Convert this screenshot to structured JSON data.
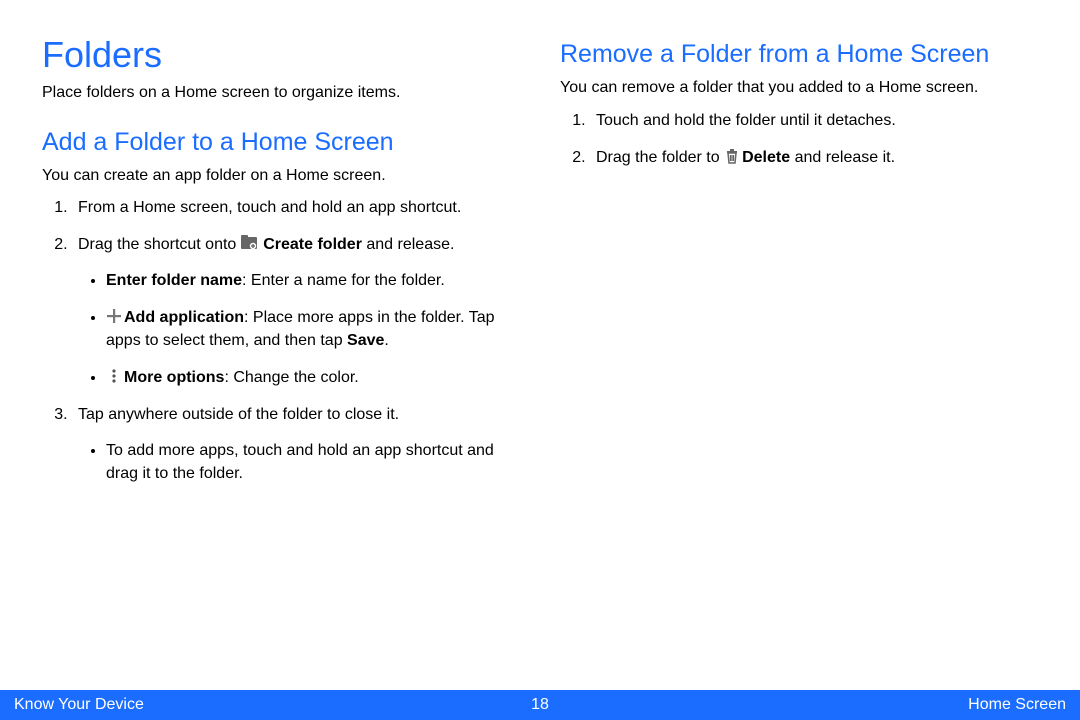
{
  "left": {
    "h1": "Folders",
    "intro": "Place folders on a Home screen to organize items.",
    "h2": "Add a Folder to a Home Screen",
    "p": "You can create an app folder on a Home screen.",
    "step1": "From a Home screen, touch and hold an app shortcut.",
    "step2_a": "Drag the shortcut onto ",
    "step2_bold": "Create folder",
    "step2_b": " and release.",
    "b1_bold": "Enter folder name",
    "b1_rest": ": Enter a name for the folder.",
    "b2_bold": "Add application",
    "b2_rest": ": Place more apps in the folder. Tap apps to select them, and then tap ",
    "b2_bold2": "Save",
    "b2_rest2": ".",
    "b3_bold": "More options",
    "b3_rest": ": Change the color.",
    "step3": "Tap anywhere outside of the folder to close it.",
    "s3b1": "To add more apps, touch and hold an app shortcut and drag it to the folder."
  },
  "right": {
    "h2": "Remove a Folder from a Home Screen",
    "p": "You can remove a folder that you added to a Home screen.",
    "step1": "Touch and hold the folder until it detaches.",
    "step2_a": "Drag the folder to ",
    "step2_bold": "Delete",
    "step2_b": "  and release it."
  },
  "footer": {
    "left": "Know Your Device",
    "page": "18",
    "right": "Home Screen"
  }
}
